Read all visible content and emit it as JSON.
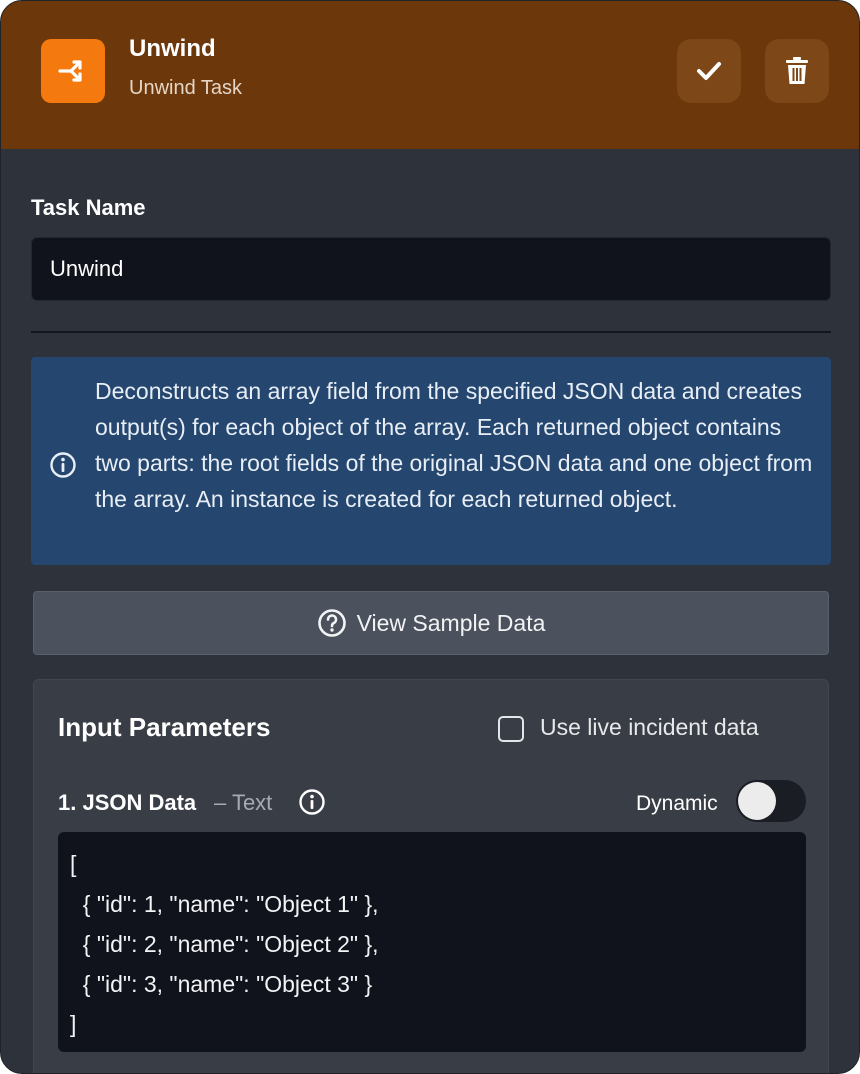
{
  "header": {
    "title": "Unwind",
    "subtitle": "Unwind Task",
    "bg_color": "#6b370b",
    "icon_color": "#f47a0f",
    "confirm_icon": "check-icon",
    "delete_icon": "trash-icon"
  },
  "task_name": {
    "label": "Task Name",
    "value": "Unwind"
  },
  "info": {
    "icon": "info-icon",
    "text": "Deconstructs an array field from the specified JSON data and creates output(s) for each object of the array. Each returned object contains two parts: the root fields of the original JSON data and one object from the array. An instance is created for each returned object."
  },
  "sample_button": {
    "icon": "question-circle-icon",
    "label": "View Sample Data"
  },
  "input_parameters": {
    "title": "Input Parameters",
    "live_data_label": "Use live incident data",
    "live_data_checked": false,
    "fields": [
      {
        "label": "1. JSON Data",
        "type_text": "– Text",
        "dynamic_label": "Dynamic",
        "dynamic_enabled": false,
        "code": "[\n  { \"id\": 1, \"name\": \"Object 1\" },\n  { \"id\": 2, \"name\": \"Object 2\" },\n  { \"id\": 3, \"name\": \"Object 3\" }\n]"
      }
    ]
  }
}
